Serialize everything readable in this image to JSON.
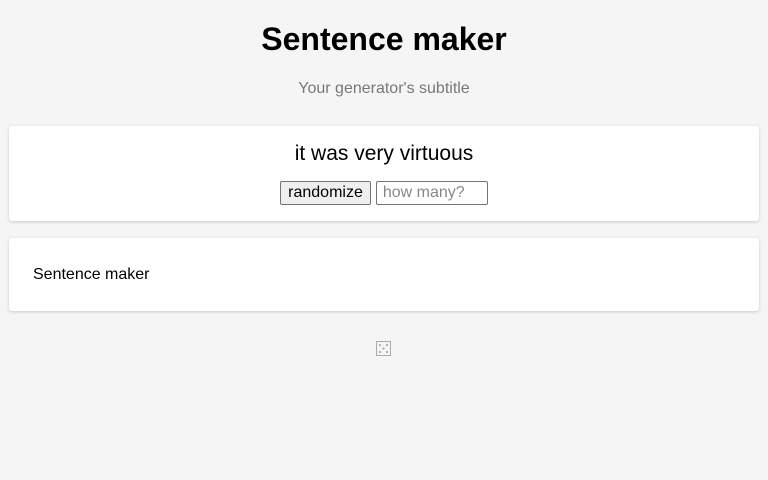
{
  "header": {
    "title": "Sentence maker",
    "subtitle": "Your generator's subtitle"
  },
  "output": {
    "text": "it was very virtuous"
  },
  "controls": {
    "randomize_label": "randomize",
    "count_placeholder": "how many?",
    "count_value": ""
  },
  "description": {
    "text": "Sentence maker"
  },
  "footer": {
    "icon": "dice-icon"
  }
}
